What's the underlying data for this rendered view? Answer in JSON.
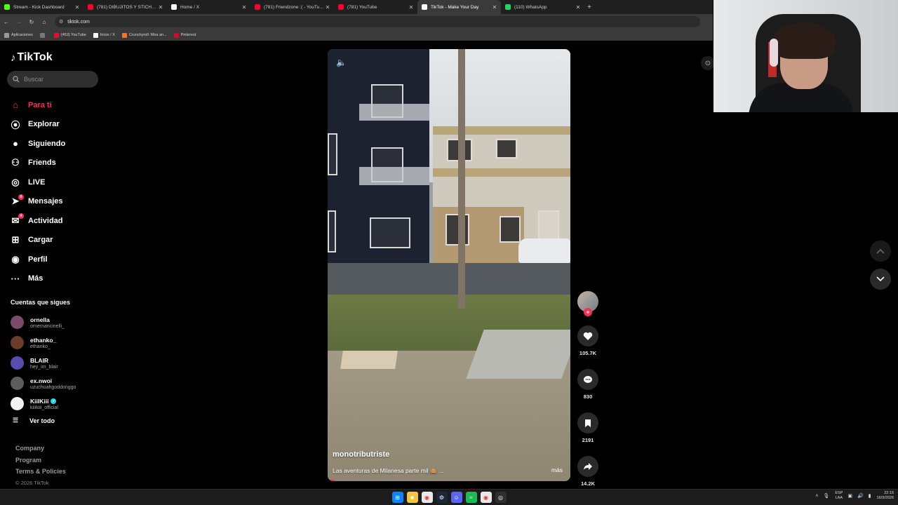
{
  "browser": {
    "tabs": [
      {
        "label": "Stream - Kick Dashboard",
        "icon": "kick-icon",
        "color": "#53fc18"
      },
      {
        "label": "(781) DIBUJITOS Y STICH CONT",
        "icon": "youtube-icon",
        "color": "#ff0033"
      },
      {
        "label": "Home / X",
        "icon": "x-icon",
        "color": "#ffffff"
      },
      {
        "label": "(781) Friendzone :( - YouTube",
        "icon": "youtube-icon",
        "color": "#ff0033"
      },
      {
        "label": "(781) YouTube",
        "icon": "youtube-icon",
        "color": "#ff0033"
      },
      {
        "label": "TikTok - Make Your Day",
        "icon": "tiktok-icon",
        "color": "#ffffff",
        "active": true
      },
      {
        "label": "(110) WhatsApp",
        "icon": "whatsapp-icon",
        "color": "#25d366"
      }
    ],
    "url": "tiktok.com",
    "bookmarks": [
      {
        "label": "Aplicaciones",
        "icon": "apps-icon"
      },
      {
        "label": "",
        "icon": "grid-icon"
      },
      {
        "label": "(453) YouTube",
        "icon": "youtube-icon"
      },
      {
        "label": "Inicio / X",
        "icon": "x-icon"
      },
      {
        "label": "Crunchyroll: Mira an...",
        "icon": "crunchyroll-icon"
      },
      {
        "label": "Pinterest",
        "icon": "pinterest-icon"
      }
    ]
  },
  "tiktok": {
    "brand": "TikTok",
    "search_placeholder": "Buscar",
    "nav": [
      {
        "label": "Para ti",
        "icon": "home-icon",
        "active": true
      },
      {
        "label": "Explorar",
        "icon": "compass-icon"
      },
      {
        "label": "Siguiendo",
        "icon": "following-avatar-icon"
      },
      {
        "label": "Friends",
        "icon": "friends-icon"
      },
      {
        "label": "LIVE",
        "icon": "live-icon"
      },
      {
        "label": "Mensajes",
        "icon": "messages-icon",
        "badge": "6"
      },
      {
        "label": "Actividad",
        "icon": "activity-icon",
        "badge": "4"
      },
      {
        "label": "Cargar",
        "icon": "upload-icon"
      },
      {
        "label": "Perfil",
        "icon": "profile-icon"
      },
      {
        "label": "Más",
        "icon": "more-icon"
      }
    ],
    "following_title": "Cuentas que sigues",
    "following": [
      {
        "name": "ornella",
        "handle": "ornemancinelli_",
        "color": "#7a4b6a"
      },
      {
        "name": "ethanko_",
        "handle": "ethanko_",
        "color": "#6b3b2b"
      },
      {
        "name": "BLAIR",
        "handle": "hey_im_blair",
        "color": "#5a4bb0"
      },
      {
        "name": "ex.nwoi",
        "handle": "uzuchuahgoddonggo",
        "color": "#5d5d5d"
      },
      {
        "name": "KiiIKiii",
        "handle": "kiiikiii_official",
        "color": "#f2f2f2",
        "verified": true
      }
    ],
    "see_all": "Ver todo",
    "footer_links": [
      "Company",
      "Program",
      "Terms & Policies"
    ],
    "copyright": "© 2026 TikTok",
    "video": {
      "author": "monotributriste",
      "caption": "Las aventuras de Milanesa parte mil 🙈 ...",
      "more": "más",
      "progress": 0.03
    },
    "actions": {
      "likes": "105.7K",
      "comments": "830",
      "saves": "2191",
      "shares": "14.2K"
    }
  },
  "taskbar": {
    "apps": [
      "start-icon",
      "file-explorer-icon",
      "chrome-icon",
      "steam-icon",
      "discord-icon",
      "spotify-icon",
      "chrome-icon",
      "obs-icon"
    ],
    "lang_top": "ESP",
    "lang_bottom": "LAA",
    "time": "22:15",
    "date": "16/3/2026"
  },
  "colors": {
    "accent": "#fe2c55",
    "background": "#000000"
  }
}
